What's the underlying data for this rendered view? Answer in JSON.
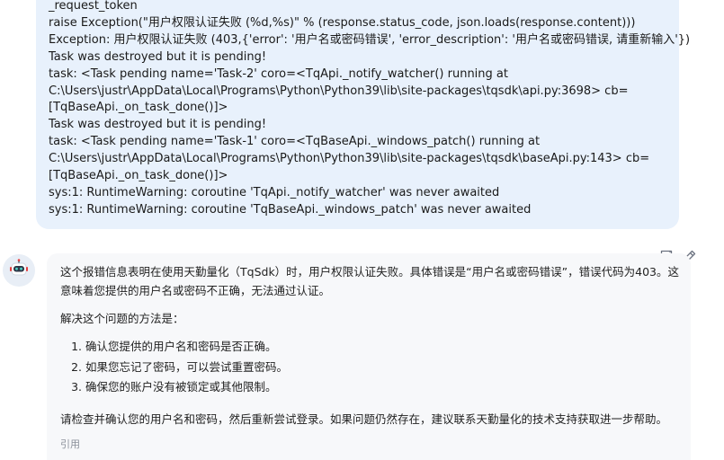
{
  "user_message": {
    "lines": [
      "_request_token",
      "raise Exception(\"用户权限认证失败 (%d,%s)\" % (response.status_code, json.loads(response.content)))",
      "Exception: 用户权限认证失败 (403,{'error': '用户名或密码错误', 'error_description': '用户名或密码错误, 请重新输入'})",
      "Task was destroyed but it is pending!",
      "task: <Task pending name='Task-2' coro=<TqApi._notify_watcher() running at",
      "C:\\Users\\justr\\AppData\\Local\\Programs\\Python\\Python39\\lib\\site-packages\\tqsdk\\api.py:3698> cb=",
      "[TqBaseApi._on_task_done()]>",
      "Task was destroyed but it is pending!",
      "task: <Task pending name='Task-1' coro=<TqBaseApi._windows_patch() running at",
      "C:\\Users\\justr\\AppData\\Local\\Programs\\Python\\Python39\\lib\\site-packages\\tqsdk\\baseApi.py:143> cb=",
      "[TqBaseApi._on_task_done()]>",
      "sys:1: RuntimeWarning: coroutine 'TqApi._notify_watcher' was never awaited",
      "sys:1: RuntimeWarning: coroutine 'TqBaseApi._windows_patch' was never awaited"
    ]
  },
  "assistant": {
    "avatar_icon": "robot-icon",
    "actions": {
      "feedback_icon": "feedback-icon",
      "edit_icon": "pencil-icon"
    },
    "para1": "这个报错信息表明在使用天勤量化（TqSdk）时，用户权限认证失败。具体错误是“用户名或密码错误”，错误代码为403。这意味着您提供的用户名或密码不正确，无法通过认证。",
    "para2": "解决这个问题的方法是：",
    "steps": [
      "确认您提供的用户名和密码是否正确。",
      "如果您忘记了密码，可以尝试重置密码。",
      "确保您的账户没有被锁定或其他限制。"
    ],
    "para3": "请检查并确认您的用户名和密码，然后重新尝试登录。如果问题仍然存在，建议联系天勤量化的技术支持获取进一步帮助。",
    "citation_label": "引用"
  },
  "colors": {
    "user_bubble": "#e8f1fc",
    "assistant_bubble": "#f7f8fa",
    "text": "#1a1a1a",
    "muted": "#8a8f99"
  }
}
